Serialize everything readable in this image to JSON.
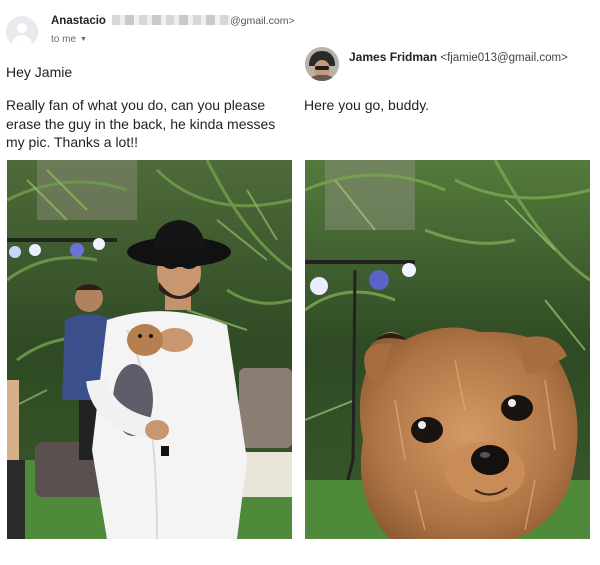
{
  "original_email": {
    "sender_name": "Anastacio",
    "sender_email_suffix": "@gmail.com>",
    "recipient": "to me",
    "greeting": "Hey Jamie",
    "body": "Really fan of what you do, can you please erase the guy in the back, he kinda messes my pic. Thanks a lot!!"
  },
  "reply_email": {
    "sender_name": "James Fridman",
    "sender_email": "<fjamie013@gmail.com>",
    "body": "Here you go, buddy."
  },
  "icons": {
    "sender_avatar": "default-person-avatar-icon",
    "recipient_caret": "caret-down-icon",
    "reply_avatar": "profile-photo"
  },
  "colors": {
    "background": "#ffffff",
    "text": "#222222",
    "secondary_text": "#666666",
    "avatar_bg": "#e8eaed"
  }
}
